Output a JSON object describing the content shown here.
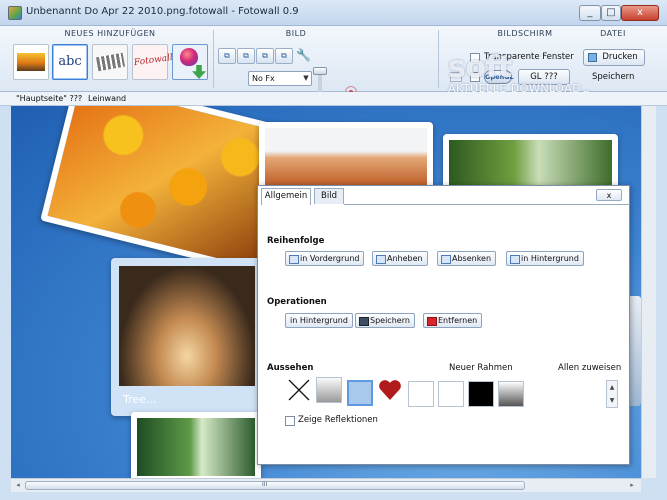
{
  "window": {
    "title": "Unbenannt Do Apr 22 2010.png.fotowall - Fotowall 0.9",
    "controls": [
      "_",
      "□",
      "x"
    ]
  },
  "toolbar": {
    "group_add": "NEUES HINZUFÜGEN",
    "group_picture": "BILD",
    "group_file": "DATEI",
    "group_screen": "BILDSCHIRM",
    "text_tool_label": "abc",
    "fotowall_tool_label": "Fotowall",
    "fx_select": "No Fx",
    "transparent_label": "Transparente Fenster",
    "gl_button": "GL ???",
    "opengl_label": "OpenGL",
    "print_button": "Drucken",
    "save_label": "Speichern"
  },
  "watermark": {
    "main": "soft ware.net",
    "sub": "AKTUELLE DOWNLOAD"
  },
  "breadcrumb": [
    "\"Hauptseite\" ???",
    "Leinwand"
  ],
  "canvas": {
    "tree_caption": "Tree..."
  },
  "dialog": {
    "tabs": [
      "Allgemein",
      "Bild"
    ],
    "close": "x",
    "order_title": "Reihenfolge",
    "order_buttons": [
      "in Vordergrund",
      "Anheben",
      "Absenken",
      "in Hintergrund"
    ],
    "ops_title": "Operationen",
    "ops_buttons": [
      "in Hintergrund",
      "Speichern",
      "Entfernen"
    ],
    "look_title": "Aussehen",
    "new_frame": "Neuer Rahmen",
    "assign_all": "Allen zuweisen",
    "reflections": "Zeige Reflektionen"
  },
  "scrollbar": {
    "h_grip": "III"
  },
  "colors": {
    "accent": "#3f7fd6",
    "heart": "#b01c1c",
    "canvas": "#3e85d3"
  }
}
